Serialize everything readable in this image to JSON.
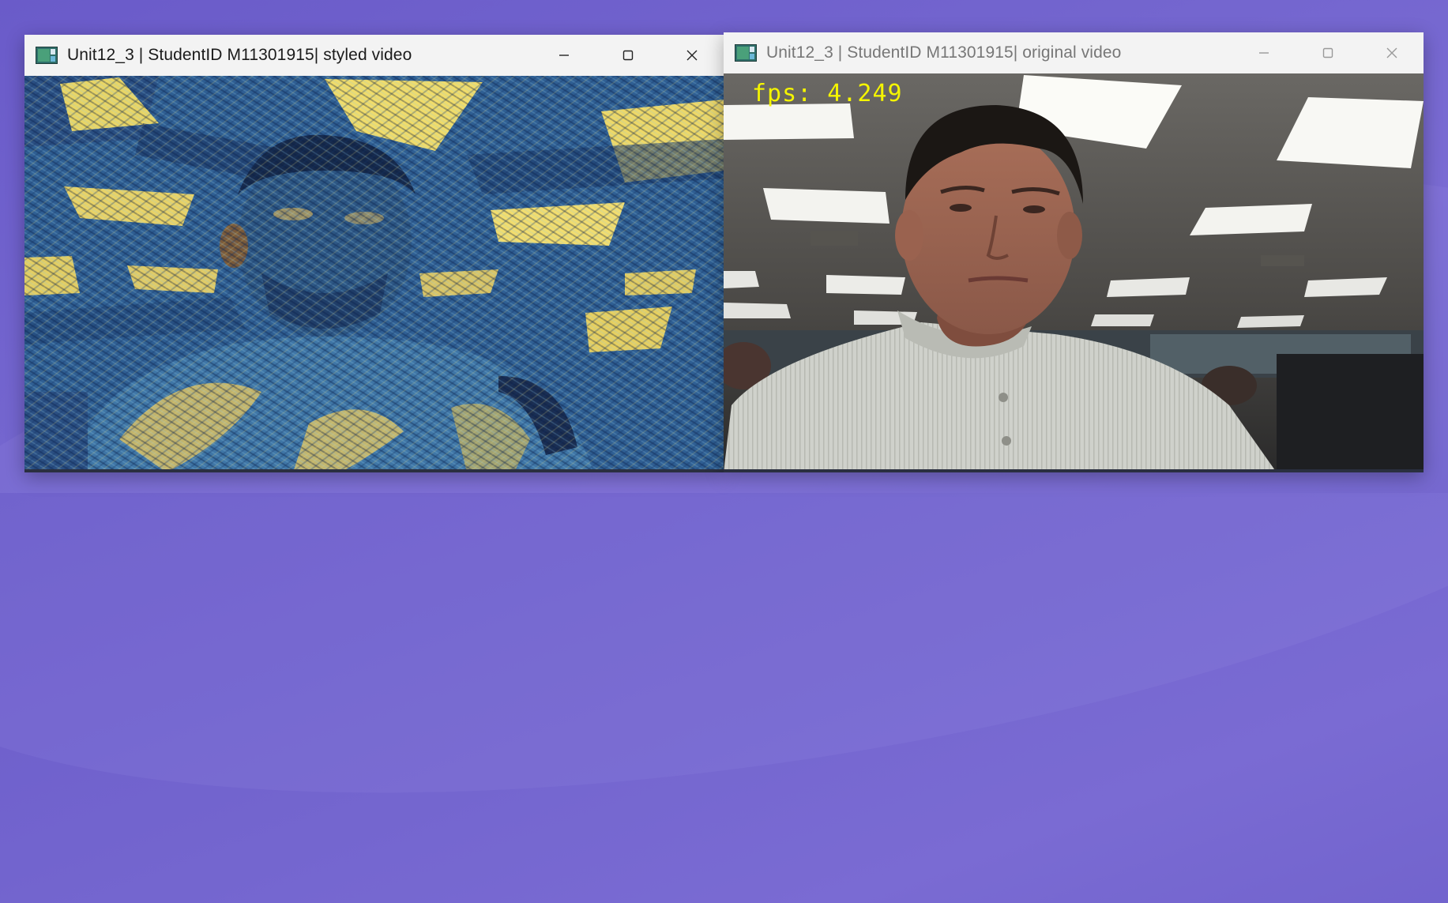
{
  "desktop": {
    "background": "#6f61cb"
  },
  "windows": [
    {
      "title": "Unit12_3 | StudentID M11301915| styled video",
      "state": "active",
      "content": "van Gogh style-transferred webcam frame"
    },
    {
      "title": "Unit12_3 | StudentID M11301915| original video",
      "state": "inactive",
      "overlay_text": "fps: 4.249",
      "overlay_color": "#f5f500",
      "content": "original webcam frame"
    }
  ],
  "controls": {
    "minimize": "minimize-icon",
    "maximize": "maximize-icon",
    "close": "close-icon"
  }
}
